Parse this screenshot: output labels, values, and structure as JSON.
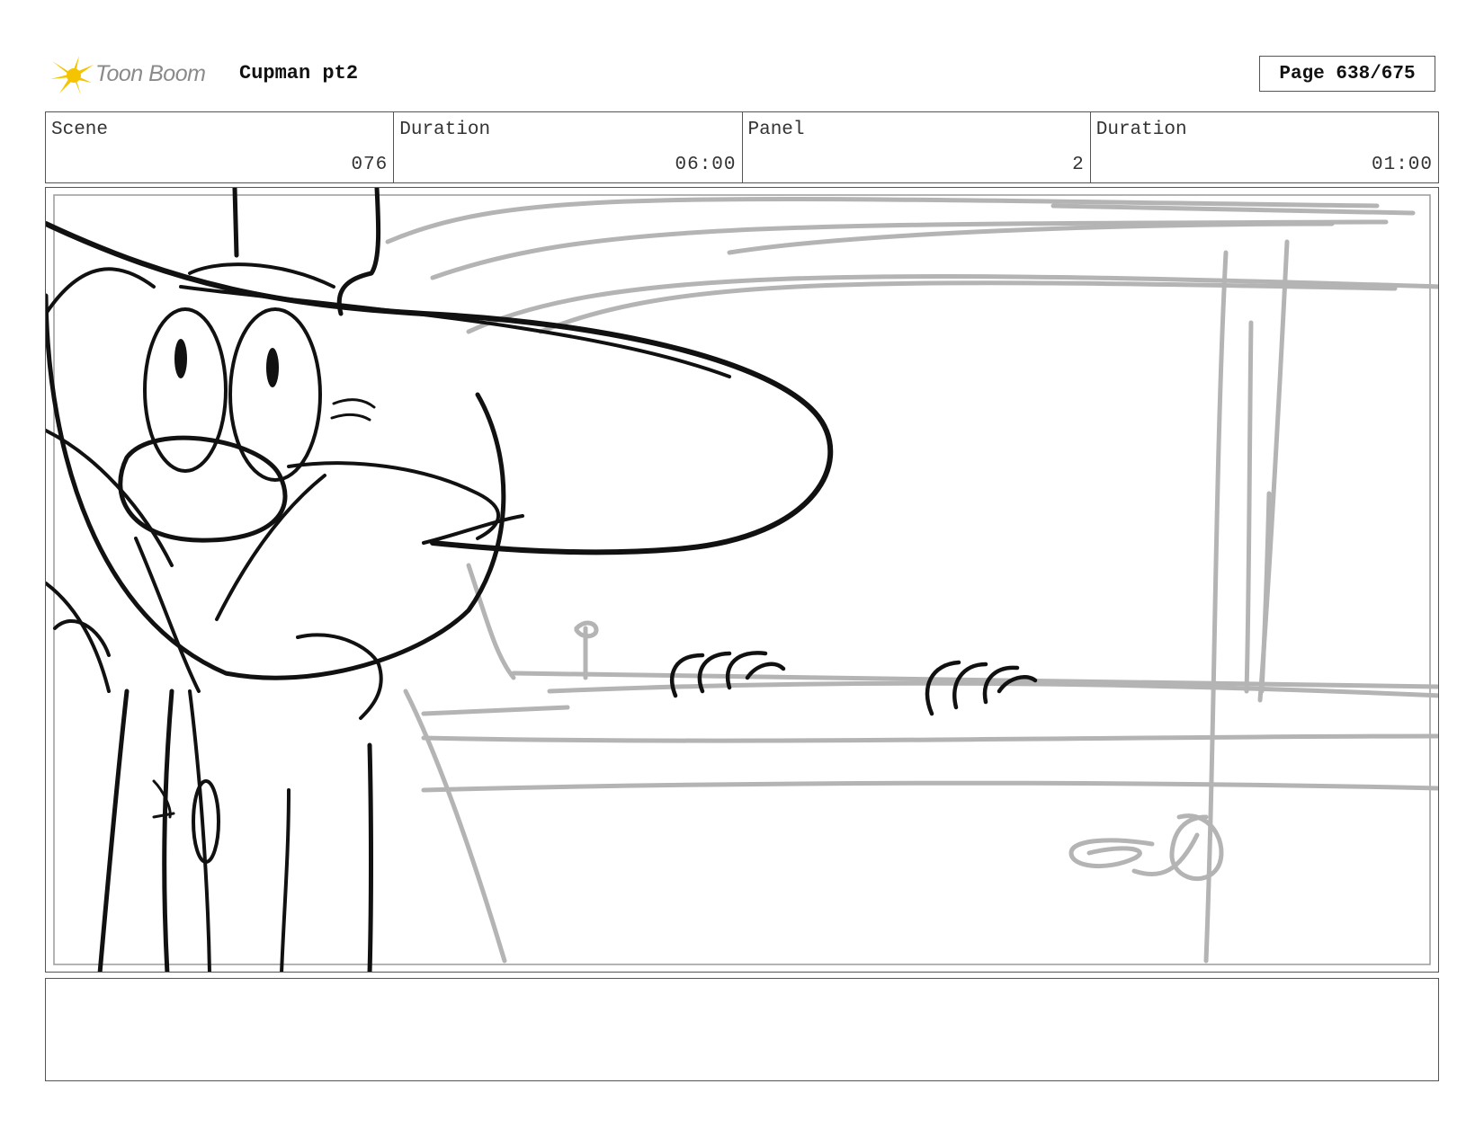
{
  "header": {
    "logo_text": "Toon Boom",
    "project_title": "Cupman pt2",
    "page_label": "Page 638/675"
  },
  "info": {
    "scene_label": "Scene",
    "scene_value": "076",
    "duration_label": "Duration",
    "duration_value": "06:00",
    "panel_label": "Panel",
    "panel_value": "2",
    "panel_duration_label": "Duration",
    "panel_duration_value": "01:00"
  },
  "panel": {
    "content": "sketch"
  },
  "notes": {
    "text": ""
  },
  "colors": {
    "logo_accent": "#f5c400",
    "border": "#555555",
    "sketch_ink": "#111111",
    "sketch_gray": "#b4b4b4"
  }
}
